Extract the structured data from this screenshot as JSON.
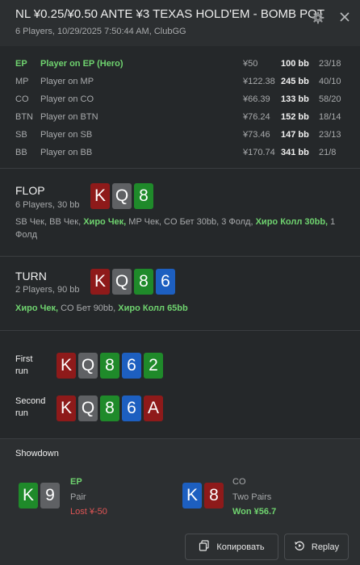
{
  "header": {
    "title": "NL ¥0.25/¥0.50 ANTE ¥3 TEXAS HOLD'EM - BOMB POT",
    "subtitle": "6 Players, 10/29/2025 7:50:44 AM, ClubGG",
    "settings_icon": "gear-icon",
    "close_icon": "close-icon"
  },
  "players": [
    {
      "pos": "EP",
      "name": "Player on EP (Hero)",
      "money": "¥50",
      "bb": "100 bb",
      "stat": "23/18",
      "hero": true
    },
    {
      "pos": "MP",
      "name": "Player on MP",
      "money": "¥122.38",
      "bb": "245 bb",
      "stat": "40/10"
    },
    {
      "pos": "CO",
      "name": "Player on CO",
      "money": "¥66.39",
      "bb": "133 bb",
      "stat": "58/20"
    },
    {
      "pos": "BTN",
      "name": "Player on BTN",
      "money": "¥76.24",
      "bb": "152 bb",
      "stat": "18/14"
    },
    {
      "pos": "SB",
      "name": "Player on SB",
      "money": "¥73.46",
      "bb": "147 bb",
      "stat": "23/13"
    },
    {
      "pos": "BB",
      "name": "Player on BB",
      "money": "¥170.74",
      "bb": "341 bb",
      "stat": "21/8"
    }
  ],
  "flop": {
    "name": "FLOP",
    "sub": "6 Players, 30 bb",
    "cards": [
      "K",
      "Q",
      "8"
    ],
    "actions": {
      "a1": "SB Чек, BB Чек, ",
      "h1": "Хиро Чек,",
      "a2": " MP Чек, CO Бет 30bb, 3 Фолд, ",
      "h2": "Хиро Колл 30bb,",
      "a3": " 1 Фолд"
    }
  },
  "turn": {
    "name": "TURN",
    "sub": "2 Players, 90 bb",
    "cards": [
      "K",
      "Q",
      "8",
      "6"
    ],
    "actions": {
      "h1": "Хиро Чек,",
      "a1": " CO Бет 90bb, ",
      "h2": "Хиро Колл 65bb"
    }
  },
  "runs": {
    "first": {
      "label_line1": "First",
      "label_line2": "run",
      "cards": [
        "K",
        "Q",
        "8",
        "6",
        "2"
      ]
    },
    "second": {
      "label_line1": "Second",
      "label_line2": "run",
      "cards": [
        "K",
        "Q",
        "8",
        "6",
        "A"
      ]
    }
  },
  "showdown": {
    "title": "Showdown",
    "left": {
      "cards": [
        "K",
        "9"
      ],
      "pos": "EP",
      "hand": "Pair",
      "result": "Lost ¥-50"
    },
    "right": {
      "cards": [
        "K",
        "8"
      ],
      "pos": "CO",
      "hand": "Two Pairs",
      "result": "Won ¥56.7"
    }
  },
  "footer": {
    "copy_label": "Копировать",
    "copy_icon": "copy-icon",
    "replay_label": "Replay",
    "replay_icon": "replay-icon"
  },
  "colors": {
    "hero_green": "#6fd36f",
    "loss_red": "#e05555",
    "win_green": "#6fd36f",
    "card_red": "#8e1a1a",
    "card_gray": "#5f6164",
    "card_green": "#1f8a2a",
    "card_blue": "#1d5fc0"
  }
}
